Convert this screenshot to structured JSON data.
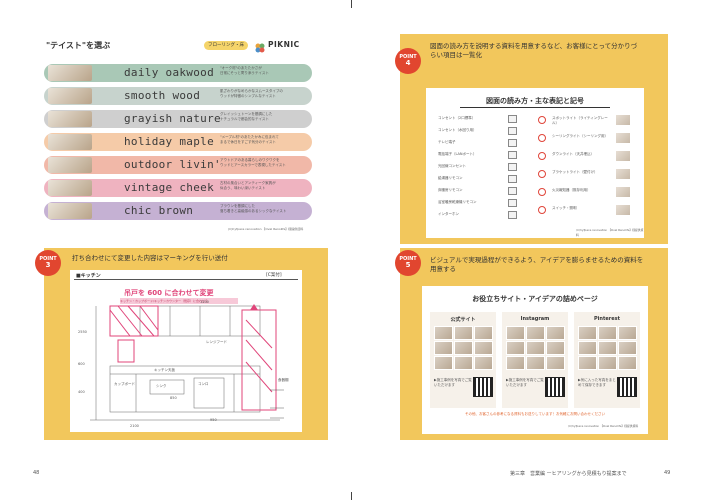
{
  "page_left": {
    "taste_panel": {
      "title": "\"テイスト\"を選ぶ",
      "tag": "フローリング・床",
      "brand": "PIKNIC",
      "rows": [
        {
          "name": "daily oakwood",
          "color": "#a9c8b6",
          "desc": "\"オーク材\"のあたたかさが\n日常にそっと寄り添うテイスト"
        },
        {
          "name": "smooth wood",
          "color": "#c7d3cd",
          "desc": "肌ざわりがなめらかなスムースタイプの\nウッドが特徴のシンプルなテイスト"
        },
        {
          "name": "grayish nature",
          "color": "#cfcfcf",
          "desc": "グレイッシュトーンを基調にした\nナチュラルで都会的なテイスト"
        },
        {
          "name": "holiday maple",
          "color": "#f5cba8",
          "desc": "\"メープル材\"のあたたかみに包まれて\nまるで休日をすごす気分のテイスト"
        },
        {
          "name": "outdoor livin'",
          "color": "#f1b8a8",
          "desc": "アウトドアのある暮らしのワクワクを\nウッドとアースカラーで表現したテイスト"
        },
        {
          "name": "vintage cheek",
          "color": "#efb3c0",
          "desc": "古材の風合いとアンティーク家具が\n似合う、味わい深いテイスト"
        },
        {
          "name": "chic brown",
          "color": "#c5b1d3",
          "desc": "ブラウンを基調にした\n落ち着きと高級感のあるシックなテイスト"
        }
      ],
      "credit": "(C)hyfpace renovation 【Ovel Renolife】様提供資料"
    },
    "point3": {
      "label": "POINT",
      "number": "3",
      "text": "打ち合わせにて変更した内容はマーキングを行い送付",
      "sheet_title": "■キッチン",
      "sheet_tag": "[C案付]",
      "note_red": "吊戸を 600 に合わせて変更",
      "note_pink": "キッチン・カップボード/キッチンカウンター（既存）に合わせる",
      "dims": [
        "2550",
        "600",
        "400",
        "850",
        "950",
        "2100",
        "1200"
      ],
      "labels": [
        "カップボード",
        "キッチン天板",
        "シンク",
        "コンロ",
        "レンジフード",
        "食器棚"
      ]
    },
    "page_number": "48"
  },
  "page_right": {
    "point4": {
      "label": "POINT",
      "number": "4",
      "text": "図面の読み方を説明する資料を用意するなど、お客様にとって分かりづらい項目は一覧化",
      "legend_title": "図面の読み方・主な表記と記号",
      "left_items": [
        "コンセント（2口標準）",
        "コンセント（水回り用）",
        "テレビ端子",
        "電話端子（LANポート）",
        "光回線コンセント",
        "給湯器リモコン",
        "床暖房リモコン",
        "浴室暖房乾燥機リモコン",
        "インターホン"
      ],
      "right_items": [
        "スポットライト（ライティングレール）",
        "シーリングライト（シーリング用）",
        "ダウンライト（天井埋込）",
        "ブラケットライト（壁付け）",
        "火災報知器（既存利用）",
        "スイッチ・照明"
      ],
      "credit": "(C)hyfpace renovation 【Ovel Renolife】様提供資料"
    },
    "point5": {
      "label": "POINT",
      "number": "5",
      "text": "ビジュアルで実現過程ができるよう、アイデアを膨らませるための資料を用意する",
      "title": "お役立ちサイト・アイデアの詰めページ",
      "columns": [
        {
          "name": "公式サイト",
          "caption": "▶施工事例を写真でご覧いただけます"
        },
        {
          "name": "Instagram",
          "caption": "▶施工事例を写真でご覧いただけます"
        },
        {
          "name": "Pinterest",
          "caption": "▶気に入った写真をまとめて保存できます"
        }
      ],
      "footer": "その他、お客さんの参考になる資料もお送りしています！お気軽にお問い合わせください",
      "credit": "(C)hyfpace renovation 【Ovel Renolife】様提供資料"
    },
    "footer_text": "第三章　営業編 ーヒアリングから見積もり提案まで",
    "page_number": "49"
  }
}
